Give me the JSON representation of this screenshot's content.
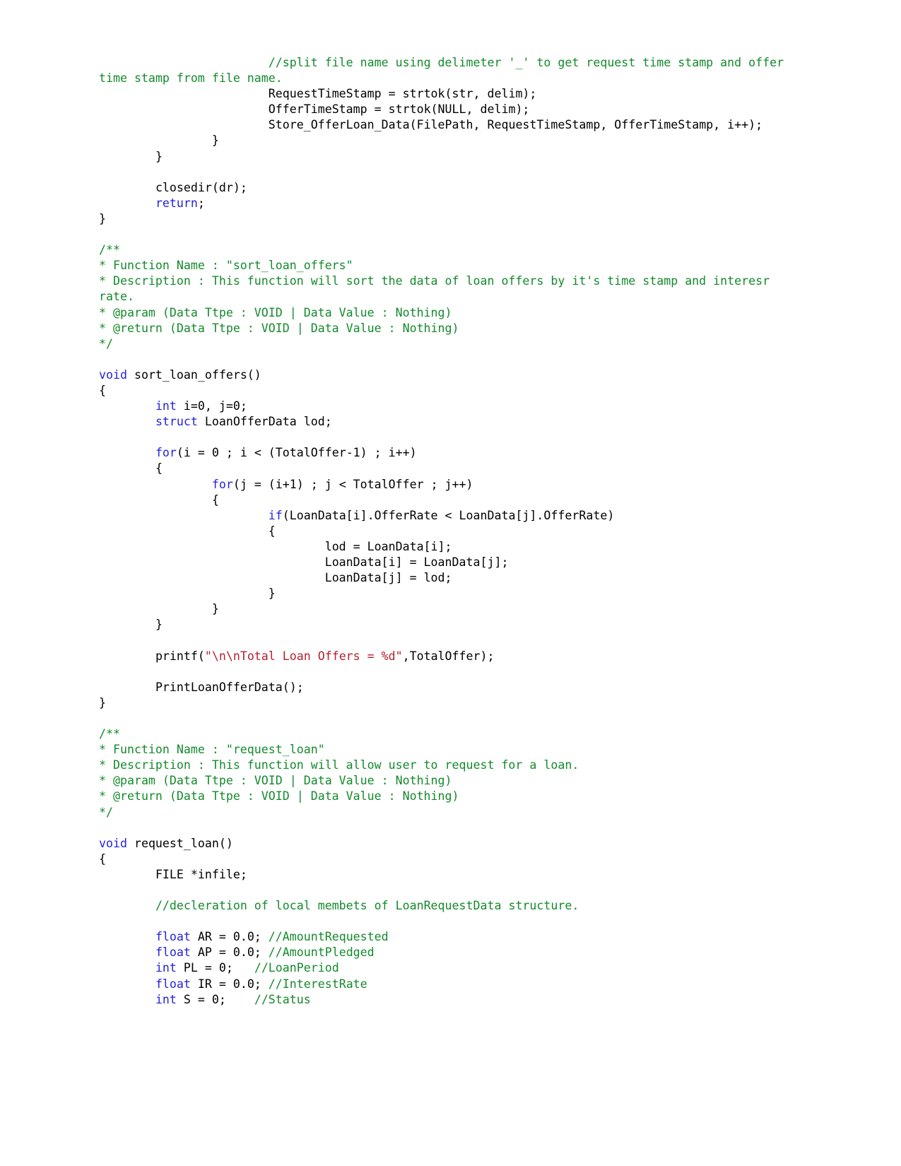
{
  "document": {
    "kind": "source-code-listing",
    "language": "C",
    "page_background": "#ffffff",
    "colors": {
      "comment": "#148a2c",
      "keyword": "#2323dc",
      "string": "#b32030",
      "default_text": "#000000"
    }
  },
  "code": {
    "lines": [
      {
        "id": "l1",
        "indent": 0,
        "segments": [
          {
            "cls": "cmt",
            "text": "                        //split file name using delimeter '_' to get request time stamp and offer time stamp from file name."
          }
        ]
      },
      {
        "id": "l2",
        "indent": 0,
        "segments": [
          {
            "cls": "plain",
            "text": "                        RequestTimeStamp = strtok(str, delim);"
          }
        ]
      },
      {
        "id": "l3",
        "indent": 0,
        "segments": [
          {
            "cls": "plain",
            "text": "                        OfferTimeStamp = strtok(NULL, delim);"
          }
        ]
      },
      {
        "id": "l4",
        "indent": 0,
        "segments": [
          {
            "cls": "plain",
            "text": "                        Store_OfferLoan_Data(FilePath, RequestTimeStamp, OfferTimeStamp, i++);"
          }
        ]
      },
      {
        "id": "l5",
        "indent": 0,
        "segments": [
          {
            "cls": "plain",
            "text": "                }"
          }
        ]
      },
      {
        "id": "l6",
        "indent": 0,
        "segments": [
          {
            "cls": "plain",
            "text": "        }"
          }
        ]
      },
      {
        "id": "l7",
        "blank": true
      },
      {
        "id": "l8",
        "indent": 0,
        "segments": [
          {
            "cls": "plain",
            "text": "        closedir(dr);"
          }
        ]
      },
      {
        "id": "l9",
        "indent": 0,
        "segments": [
          {
            "cls": "plain",
            "text": "        "
          },
          {
            "cls": "kw",
            "text": "return"
          },
          {
            "cls": "plain",
            "text": ";"
          }
        ]
      },
      {
        "id": "l10",
        "indent": 0,
        "segments": [
          {
            "cls": "plain",
            "text": "}"
          }
        ]
      },
      {
        "id": "l11",
        "blank": true
      },
      {
        "id": "l12",
        "indent": 0,
        "segments": [
          {
            "cls": "cmt",
            "text": "/**"
          }
        ]
      },
      {
        "id": "l13",
        "indent": 0,
        "segments": [
          {
            "cls": "cmt",
            "text": "* Function Name : \"sort_loan_offers\""
          }
        ]
      },
      {
        "id": "l14",
        "indent": 0,
        "segments": [
          {
            "cls": "cmt",
            "text": "* Description : This function will sort the data of loan offers by it's time stamp and interesr rate."
          }
        ]
      },
      {
        "id": "l15",
        "indent": 0,
        "segments": [
          {
            "cls": "cmt",
            "text": "* @param (Data Ttpe : VOID | Data Value : Nothing)"
          }
        ]
      },
      {
        "id": "l16",
        "indent": 0,
        "segments": [
          {
            "cls": "cmt",
            "text": "* @return (Data Ttpe : VOID | Data Value : Nothing)"
          }
        ]
      },
      {
        "id": "l17",
        "indent": 0,
        "segments": [
          {
            "cls": "cmt",
            "text": "*/"
          }
        ]
      },
      {
        "id": "l18",
        "blank": true
      },
      {
        "id": "l19",
        "indent": 0,
        "segments": [
          {
            "cls": "kw",
            "text": "void"
          },
          {
            "cls": "plain",
            "text": " sort_loan_offers()"
          }
        ]
      },
      {
        "id": "l20",
        "indent": 0,
        "segments": [
          {
            "cls": "plain",
            "text": "{"
          }
        ]
      },
      {
        "id": "l21",
        "indent": 0,
        "segments": [
          {
            "cls": "plain",
            "text": "        "
          },
          {
            "cls": "kw",
            "text": "int"
          },
          {
            "cls": "plain",
            "text": " i=0, j=0;"
          }
        ]
      },
      {
        "id": "l22",
        "indent": 0,
        "segments": [
          {
            "cls": "plain",
            "text": "        "
          },
          {
            "cls": "kw",
            "text": "struct"
          },
          {
            "cls": "plain",
            "text": " LoanOfferData lod;"
          }
        ]
      },
      {
        "id": "l23",
        "blank": true
      },
      {
        "id": "l24",
        "indent": 0,
        "segments": [
          {
            "cls": "plain",
            "text": "        "
          },
          {
            "cls": "kw",
            "text": "for"
          },
          {
            "cls": "plain",
            "text": "(i = 0 ; i < (TotalOffer-1) ; i++)"
          }
        ]
      },
      {
        "id": "l25",
        "indent": 0,
        "segments": [
          {
            "cls": "plain",
            "text": "        {"
          }
        ]
      },
      {
        "id": "l26",
        "indent": 0,
        "segments": [
          {
            "cls": "plain",
            "text": "                "
          },
          {
            "cls": "kw",
            "text": "for"
          },
          {
            "cls": "plain",
            "text": "(j = (i+1) ; j < TotalOffer ; j++)"
          }
        ]
      },
      {
        "id": "l27",
        "indent": 0,
        "segments": [
          {
            "cls": "plain",
            "text": "                {"
          }
        ]
      },
      {
        "id": "l28",
        "indent": 0,
        "segments": [
          {
            "cls": "plain",
            "text": "                        "
          },
          {
            "cls": "kw",
            "text": "if"
          },
          {
            "cls": "plain",
            "text": "(LoanData[i].OfferRate < LoanData[j].OfferRate)"
          }
        ]
      },
      {
        "id": "l29",
        "indent": 0,
        "segments": [
          {
            "cls": "plain",
            "text": "                        {"
          }
        ]
      },
      {
        "id": "l30",
        "indent": 0,
        "segments": [
          {
            "cls": "plain",
            "text": "                                lod = LoanData[i];"
          }
        ]
      },
      {
        "id": "l31",
        "indent": 0,
        "segments": [
          {
            "cls": "plain",
            "text": "                                LoanData[i] = LoanData[j];"
          }
        ]
      },
      {
        "id": "l32",
        "indent": 0,
        "segments": [
          {
            "cls": "plain",
            "text": "                                LoanData[j] = lod;"
          }
        ]
      },
      {
        "id": "l33",
        "indent": 0,
        "segments": [
          {
            "cls": "plain",
            "text": "                        }"
          }
        ]
      },
      {
        "id": "l34",
        "indent": 0,
        "segments": [
          {
            "cls": "plain",
            "text": "                }"
          }
        ]
      },
      {
        "id": "l35",
        "indent": 0,
        "segments": [
          {
            "cls": "plain",
            "text": "        }"
          }
        ]
      },
      {
        "id": "l36",
        "blank": true
      },
      {
        "id": "l37",
        "indent": 0,
        "segments": [
          {
            "cls": "plain",
            "text": "        printf("
          },
          {
            "cls": "str",
            "text": "\"\\n\\nTotal Loan Offers = %d\""
          },
          {
            "cls": "plain",
            "text": ",TotalOffer);"
          }
        ]
      },
      {
        "id": "l38",
        "blank": true
      },
      {
        "id": "l39",
        "indent": 0,
        "segments": [
          {
            "cls": "plain",
            "text": "        PrintLoanOfferData();"
          }
        ]
      },
      {
        "id": "l40",
        "indent": 0,
        "segments": [
          {
            "cls": "plain",
            "text": "}"
          }
        ]
      },
      {
        "id": "l41",
        "blank": true
      },
      {
        "id": "l42",
        "indent": 0,
        "segments": [
          {
            "cls": "cmt",
            "text": "/**"
          }
        ]
      },
      {
        "id": "l43",
        "indent": 0,
        "segments": [
          {
            "cls": "cmt",
            "text": "* Function Name : \"request_loan\""
          }
        ]
      },
      {
        "id": "l44",
        "indent": 0,
        "segments": [
          {
            "cls": "cmt",
            "text": "* Description : This function will allow user to request for a loan."
          }
        ]
      },
      {
        "id": "l45",
        "indent": 0,
        "segments": [
          {
            "cls": "cmt",
            "text": "* @param (Data Ttpe : VOID | Data Value : Nothing)"
          }
        ]
      },
      {
        "id": "l46",
        "indent": 0,
        "segments": [
          {
            "cls": "cmt",
            "text": "* @return (Data Ttpe : VOID | Data Value : Nothing)"
          }
        ]
      },
      {
        "id": "l47",
        "indent": 0,
        "segments": [
          {
            "cls": "cmt",
            "text": "*/"
          }
        ]
      },
      {
        "id": "l48",
        "blank": true
      },
      {
        "id": "l49",
        "indent": 0,
        "segments": [
          {
            "cls": "kw",
            "text": "void"
          },
          {
            "cls": "plain",
            "text": " request_loan()"
          }
        ]
      },
      {
        "id": "l50",
        "indent": 0,
        "segments": [
          {
            "cls": "plain",
            "text": "{"
          }
        ]
      },
      {
        "id": "l51",
        "indent": 0,
        "segments": [
          {
            "cls": "plain",
            "text": "        FILE *infile;"
          }
        ]
      },
      {
        "id": "l52",
        "blank": true
      },
      {
        "id": "l53",
        "indent": 0,
        "segments": [
          {
            "cls": "plain",
            "text": "        "
          },
          {
            "cls": "cmt",
            "text": "//decleration of local membets of LoanRequestData structure."
          }
        ]
      },
      {
        "id": "l54",
        "blank": true
      },
      {
        "id": "l55",
        "indent": 0,
        "segments": [
          {
            "cls": "plain",
            "text": "        "
          },
          {
            "cls": "kw",
            "text": "float"
          },
          {
            "cls": "plain",
            "text": " AR = 0.0; "
          },
          {
            "cls": "cmt",
            "text": "//AmountRequested"
          }
        ]
      },
      {
        "id": "l56",
        "indent": 0,
        "segments": [
          {
            "cls": "plain",
            "text": "        "
          },
          {
            "cls": "kw",
            "text": "float"
          },
          {
            "cls": "plain",
            "text": " AP = 0.0; "
          },
          {
            "cls": "cmt",
            "text": "//AmountPledged"
          }
        ]
      },
      {
        "id": "l57",
        "indent": 0,
        "segments": [
          {
            "cls": "plain",
            "text": "        "
          },
          {
            "cls": "kw",
            "text": "int"
          },
          {
            "cls": "plain",
            "text": " PL = 0;   "
          },
          {
            "cls": "cmt",
            "text": "//LoanPeriod"
          }
        ]
      },
      {
        "id": "l58",
        "indent": 0,
        "segments": [
          {
            "cls": "plain",
            "text": "        "
          },
          {
            "cls": "kw",
            "text": "float"
          },
          {
            "cls": "plain",
            "text": " IR = 0.0; "
          },
          {
            "cls": "cmt",
            "text": "//InterestRate"
          }
        ]
      },
      {
        "id": "l59",
        "indent": 0,
        "segments": [
          {
            "cls": "plain",
            "text": "        "
          },
          {
            "cls": "kw",
            "text": "int"
          },
          {
            "cls": "plain",
            "text": " S = 0;    "
          },
          {
            "cls": "cmt",
            "text": "//Status"
          }
        ]
      }
    ]
  }
}
